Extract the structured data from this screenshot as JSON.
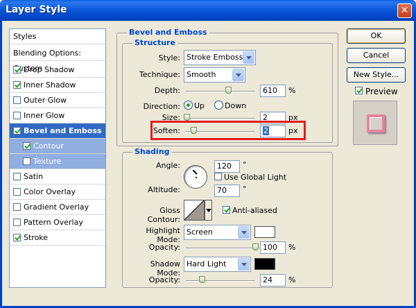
{
  "window": {
    "title": "Layer Style",
    "close_glyph": "✕"
  },
  "styles_list": {
    "items": [
      {
        "label": "Styles",
        "checked": null
      },
      {
        "label": "Blending Options: Custom",
        "checked": null
      },
      {
        "label": "Drop Shadow",
        "checked": true
      },
      {
        "label": "Inner Shadow",
        "checked": true
      },
      {
        "label": "Outer Glow",
        "checked": false
      },
      {
        "label": "Inner Glow",
        "checked": false
      },
      {
        "label": "Bevel and Emboss",
        "checked": true,
        "selected": true
      },
      {
        "label": "Contour",
        "checked": true,
        "sub": true
      },
      {
        "label": "Texture",
        "checked": false,
        "sub": true
      },
      {
        "label": "Satin",
        "checked": false
      },
      {
        "label": "Color Overlay",
        "checked": false
      },
      {
        "label": "Gradient Overlay",
        "checked": false
      },
      {
        "label": "Pattern Overlay",
        "checked": false
      },
      {
        "label": "Stroke",
        "checked": true
      }
    ]
  },
  "bevel": {
    "title": "Bevel and Emboss",
    "structure_title": "Structure",
    "style_label": "Style:",
    "style_value": "Stroke Emboss",
    "technique_label": "Technique:",
    "technique_value": "Smooth",
    "depth_label": "Depth:",
    "depth_value": "610",
    "depth_unit": "%",
    "direction_label": "Direction:",
    "direction_up": "Up",
    "direction_down": "Down",
    "size_label": "Size:",
    "size_value": "2",
    "size_unit": "px",
    "soften_label": "Soften:",
    "soften_value": "2",
    "soften_unit": "px"
  },
  "shading": {
    "title": "Shading",
    "angle_label": "Angle:",
    "angle_value": "120",
    "angle_unit": "°",
    "use_global_light": "Use Global Light",
    "altitude_label": "Altitude:",
    "altitude_value": "70",
    "altitude_unit": "°",
    "gloss_contour_label": "Gloss Contour:",
    "anti_aliased": "Anti-aliased",
    "highlight_mode_label": "Highlight Mode:",
    "highlight_mode_value": "Screen",
    "highlight_color": "#ffffff",
    "highlight_opacity_label": "Opacity:",
    "highlight_opacity_value": "100",
    "opacity_unit": "%",
    "shadow_mode_label": "Shadow Mode:",
    "shadow_mode_value": "Hard Light",
    "shadow_color": "#000000",
    "shadow_opacity_label": "Opacity:",
    "shadow_opacity_value": "24"
  },
  "buttons": {
    "ok": "OK",
    "cancel": "Cancel",
    "new_style": "New Style...",
    "preview": "Preview"
  }
}
